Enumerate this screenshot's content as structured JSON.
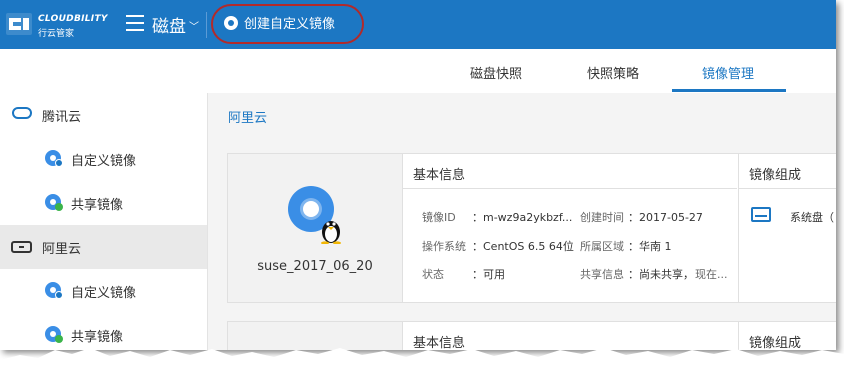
{
  "brand": {
    "name": "CLOUDBILITY",
    "subtitle": "行云管家"
  },
  "header": {
    "module": "磁盘",
    "create_button": "创建自定义镜像"
  },
  "tabs": [
    {
      "label": "磁盘快照",
      "active": false
    },
    {
      "label": "快照策略",
      "active": false
    },
    {
      "label": "镜像管理",
      "active": true
    }
  ],
  "sidebar": {
    "items": [
      {
        "label": "腾讯云",
        "icon": "cloud-icon",
        "level": 1
      },
      {
        "label": "自定义镜像",
        "icon": "disc-icon",
        "level": 2
      },
      {
        "label": "共享镜像",
        "icon": "shared-disc-icon",
        "level": 2
      },
      {
        "label": "阿里云",
        "icon": "aliyun-icon",
        "level": 1,
        "selected": true
      },
      {
        "label": "自定义镜像",
        "icon": "disc-icon",
        "level": 2
      },
      {
        "label": "共享镜像",
        "icon": "shared-disc-icon",
        "level": 2
      }
    ]
  },
  "main": {
    "breadcrumb": "阿里云",
    "image": {
      "name": "suse_2017_06_20",
      "basic_info_title": "基本信息",
      "composition_title": "镜像组成",
      "fields": {
        "id_label": "镜像ID",
        "id_value": "：m-wz9a2ykbzf...",
        "os_label": "操作系统",
        "os_value": "：CentOS 6.5 64位",
        "status_label": "状态",
        "status_value": "：可用",
        "created_label": "创建时间",
        "created_value": "：2017-05-27",
        "region_label": "所属区域",
        "region_value": "：华南 1",
        "share_label": "共享信息",
        "share_value": "：尚未共享，",
        "share_action": "现在..."
      },
      "system_disk": "系统盘（"
    },
    "next_card": {
      "basic_info_title": "基本信息",
      "composition_title": "镜像组成"
    }
  },
  "colors": {
    "primary": "#1c77c3",
    "highlight_ring": "#b22a2a",
    "green": "#3bb44a"
  }
}
